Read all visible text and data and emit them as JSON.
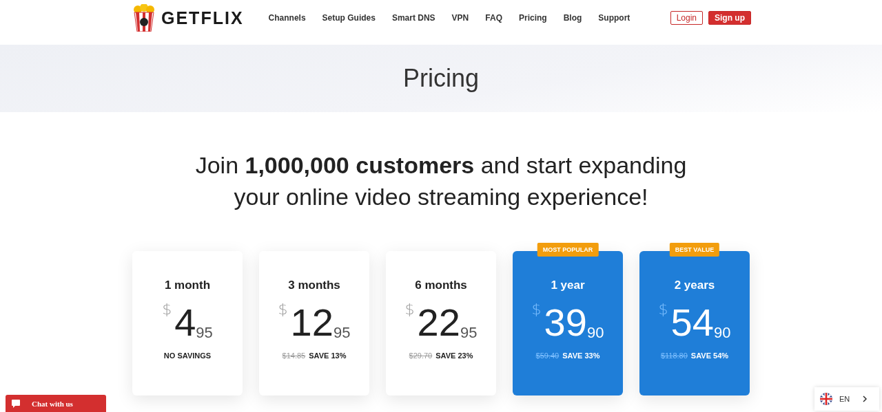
{
  "header": {
    "logo_text": "GETFLIX",
    "nav": [
      {
        "label": "Channels",
        "selected": false
      },
      {
        "label": "Setup Guides",
        "selected": false
      },
      {
        "label": "Smart DNS",
        "selected": false
      },
      {
        "label": "VPN",
        "selected": false
      },
      {
        "label": "FAQ",
        "selected": false
      },
      {
        "label": "Pricing",
        "selected": false
      },
      {
        "label": "Blog",
        "selected": false
      },
      {
        "label": "Support",
        "selected": false
      }
    ],
    "login": "Login",
    "signup": "Sign up"
  },
  "hero": {
    "title": "Pricing"
  },
  "headline_lines": [
    "Join **1,000,000 customers** and start expanding",
    "your online video streaming experience!"
  ],
  "plans": [
    {
      "name": "1 month",
      "featured": false,
      "currency": "$",
      "whole": "4",
      "cents": "95",
      "savings": "NO SAVINGS"
    },
    {
      "name": "3 months",
      "featured": false,
      "currency": "$",
      "whole": "12",
      "cents": "95",
      "old_price": "$14.85",
      "savings": "SAVE 13%"
    },
    {
      "name": "6 months",
      "featured": false,
      "currency": "$",
      "whole": "22",
      "cents": "95",
      "old_price": "$29.70",
      "savings": "SAVE 23%"
    },
    {
      "name": "1 year",
      "featured": true,
      "badge": "MOST POPULAR",
      "currency": "$",
      "whole": "39",
      "cents": "90",
      "old_price": "$59.40",
      "savings": "SAVE 33%"
    },
    {
      "name": "2 years",
      "featured": true,
      "badge": "BEST VALUE",
      "currency": "$",
      "whole": "54",
      "cents": "90",
      "old_price": "$118.80",
      "savings": "SAVE 54%"
    }
  ],
  "chat": {
    "label": "Chat with us"
  },
  "language": {
    "code": "EN"
  }
}
